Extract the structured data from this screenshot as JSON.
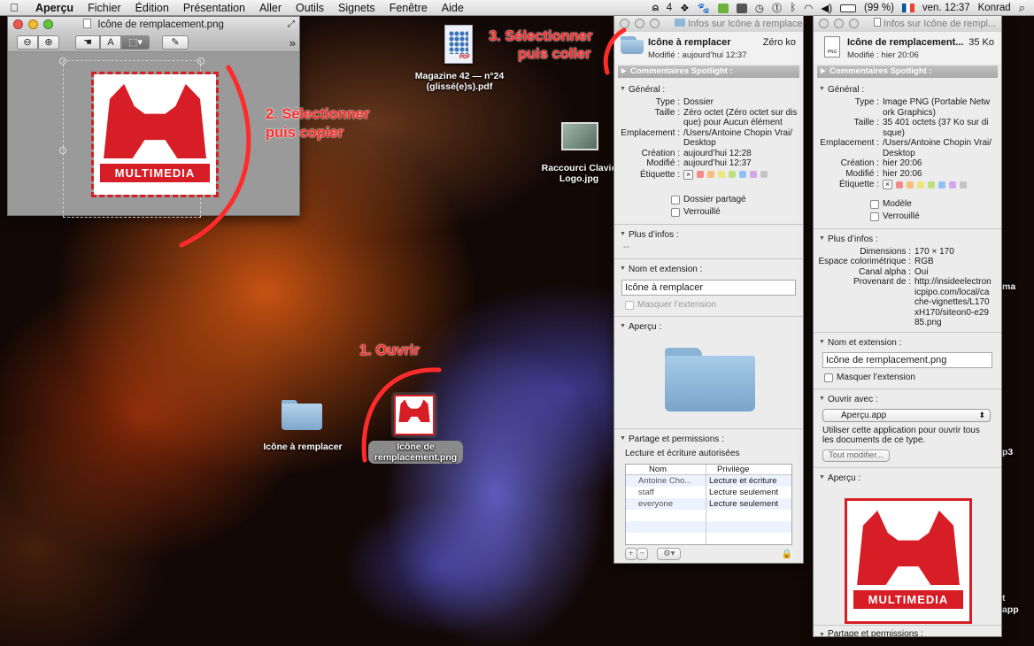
{
  "menubar": {
    "app": "Aperçu",
    "items": [
      "Fichier",
      "Édition",
      "Présentation",
      "Aller",
      "Outils",
      "Signets",
      "Fenêtre",
      "Aide"
    ],
    "badge": "4",
    "battery": "(99 %)",
    "clock": "ven. 12:37",
    "user": "Konrad"
  },
  "desktop": {
    "pdf_label": "Magazine 42 — n°24 (glissé(e)s).pdf",
    "shortcut_label": "Raccourci Clavie Logo.jpg",
    "folder_label": "Icône à remplacer",
    "png_label": "Icône de remplacement.png",
    "edge_labels": [
      "ma",
      "p3",
      "t",
      "app"
    ]
  },
  "annotations": {
    "step1": "1. Ouvrir",
    "step2a": "2. Sélectionner",
    "step2b": "puis copier",
    "step3a": "3. Sélectionner",
    "step3b": "puis coller"
  },
  "preview": {
    "title": "Icône de remplacement.png",
    "logo_word": "MULTIMEDIA"
  },
  "info_folder": {
    "title": "Infos sur Icône à remplacer",
    "name": "Icône à remplacer",
    "size": "Zéro ko",
    "modified": "Modifié : aujourd’hui 12:37",
    "spotlight": "Commentaires Spotlight :",
    "general": "Général :",
    "rows": [
      {
        "k": "Type :",
        "v": "Dossier"
      },
      {
        "k": "Taille :",
        "v": "Zéro octet (Zéro octet sur disque) pour Aucun élément"
      },
      {
        "k": "Emplacement :",
        "v": "/Users/Antoine Chopin Vrai/Desktop"
      },
      {
        "k": "Création :",
        "v": "aujourd’hui 12:28"
      },
      {
        "k": "Modifié :",
        "v": "aujourd’hui 12:37"
      }
    ],
    "label_key": "Étiquette :",
    "checks": [
      "Dossier partagé",
      "Verrouillé"
    ],
    "more": "Plus d’infos :",
    "more_value": "--",
    "name_ext": "Nom et extension :",
    "name_value": "Icône à remplacer",
    "hide_ext": "Masquer l’extension",
    "apercu": "Aperçu :",
    "sharing": "Partage et permissions :",
    "sharing_note": "Lecture et écriture autorisées",
    "table_head": [
      "Nom",
      "Privilège"
    ],
    "table_rows": [
      [
        "Antoine Cho...",
        "Lecture et écriture"
      ],
      [
        "staff",
        "Lecture seulement"
      ],
      [
        "everyone",
        "Lecture seulement"
      ]
    ]
  },
  "info_png": {
    "title": "Infos sur Icône de rempl...",
    "name": "Icône de remplacement...",
    "size": "35 Ko",
    "modified": "Modifié : hier 20:06",
    "spotlight": "Commentaires Spotlight :",
    "general": "Général :",
    "rows": [
      {
        "k": "Type :",
        "v": "Image PNG (Portable Network Graphics)"
      },
      {
        "k": "Taille :",
        "v": "35 401 octets (37 Ko sur disque)"
      },
      {
        "k": "Emplacement :",
        "v": "/Users/Antoine Chopin Vrai/Desktop"
      },
      {
        "k": "Création :",
        "v": "hier 20:06"
      },
      {
        "k": "Modifié :",
        "v": "hier 20:06"
      }
    ],
    "label_key": "Étiquette :",
    "checks": [
      "Modèle",
      "Verrouillé"
    ],
    "more": "Plus d’infos :",
    "more_rows": [
      {
        "k": "Dimensions :",
        "v": "170 × 170"
      },
      {
        "k": "Espace colorimétrique :",
        "v": "RGB"
      },
      {
        "k": "Canal alpha :",
        "v": "Oui"
      },
      {
        "k": "Provenant de :",
        "v": "http://insideelectronicpipo.com/local/cache-vignettes/L170xH170/siteon0-e2985.png"
      }
    ],
    "name_ext": "Nom et extension :",
    "name_value": "Icône de remplacement.png",
    "hide_ext": "Masquer l’extension",
    "open_with": "Ouvrir avec :",
    "app": "Aperçu.app",
    "open_note": "Utiliser cette application pour ouvrir tous les documents de ce type.",
    "change_all": "Tout modifier...",
    "apercu": "Aperçu :",
    "sharing": "Partage et permissions :",
    "logo_word": "MULTIMEDIA"
  },
  "colors": {
    "accent": "#d71e26",
    "annotation": "#ff2b2b"
  }
}
